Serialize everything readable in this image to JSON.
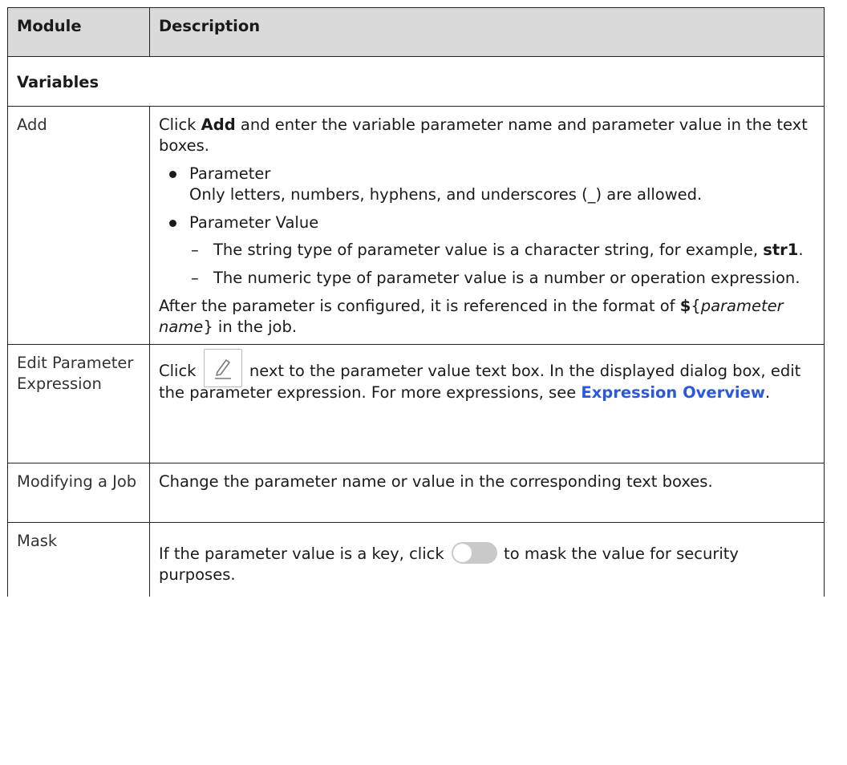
{
  "top_fragment": "",
  "table": {
    "headers": [
      "Module",
      "Description"
    ],
    "section": "Variables",
    "add": {
      "module": "Add",
      "intro_pre": "Click ",
      "intro_bold": "Add",
      "intro_post": " and enter the variable parameter name and parameter value in the text boxes.",
      "bullet1_title": "Parameter",
      "bullet1_text": "Only letters, numbers, hyphens, and underscores (_) are allowed.",
      "bullet2_title": "Parameter Value",
      "dash1_pre": "The string type of parameter value is a character string, for example, ",
      "dash1_bold": "str1",
      "dash1_post": ".",
      "dash2": "The numeric type of parameter value is a number or operation expression.",
      "after_pre": "After the parameter is configured, it is referenced in the format of ",
      "after_dollar": "$",
      "after_open": "{",
      "after_italic": "parameter name",
      "after_close": "}",
      "after_post": " in the job."
    },
    "edit": {
      "module": "Edit Parameter Expression",
      "pre": "Click ",
      "icon": "edit-pencil-icon",
      "post": " next to the parameter value text box. In the displayed dialog box, edit the parameter expression. For more expressions, see ",
      "link": "Expression Overview",
      "end": "."
    },
    "modify": {
      "module": "Modifying a Job",
      "text": "Change the parameter name or value in the corresponding text boxes."
    },
    "mask": {
      "module": "Mask",
      "pre": "If the parameter value is a key, click ",
      "icon": "toggle-switch-icon",
      "post": " to mask the value for security purposes."
    }
  },
  "colors": {
    "header_bg": "#dadada",
    "border": "#222222",
    "link": "#2a5ad9",
    "toggle_off": "#c9c9c9"
  }
}
